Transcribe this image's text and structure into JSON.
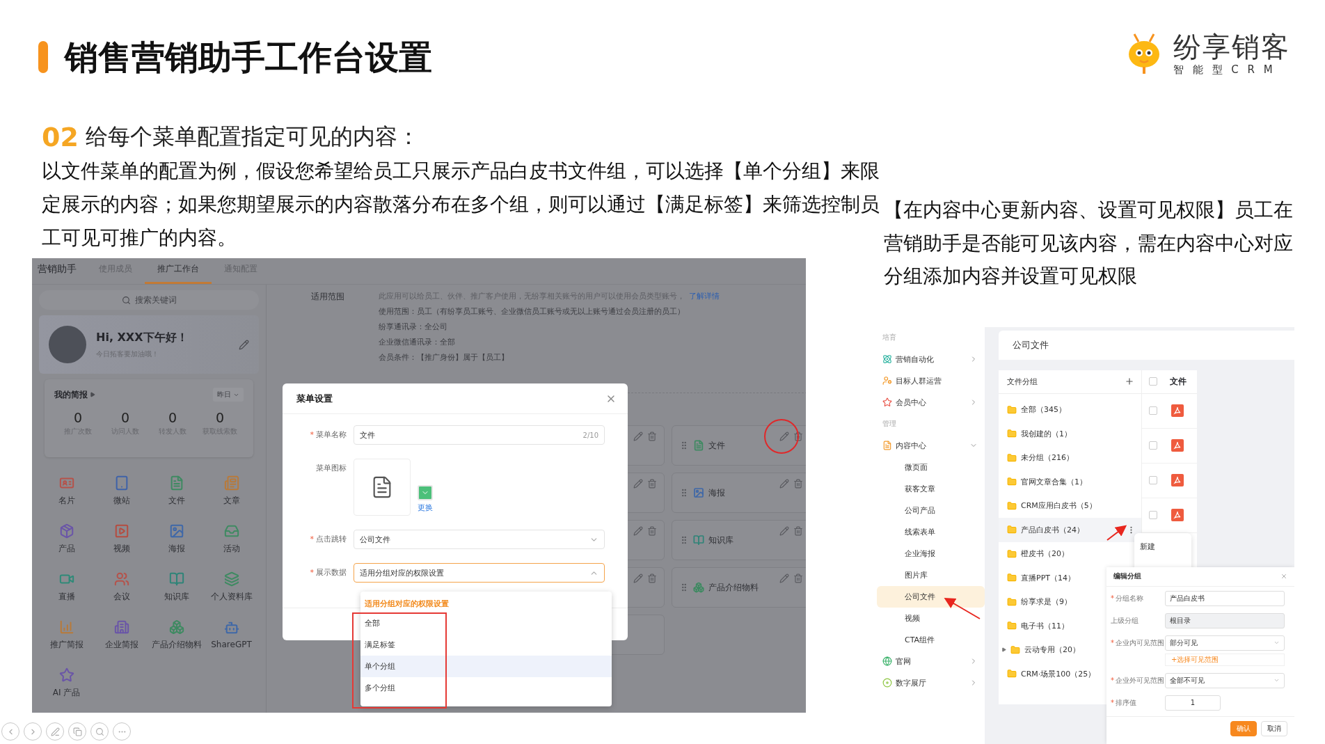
{
  "header": {
    "title": "销售营销助手工作台设置",
    "logo_name": "纷享销客",
    "logo_tagline": "智 能 型 C R M"
  },
  "intro": {
    "number": "02",
    "heading": "给每个菜单配置指定可见的内容：",
    "paragraph": "以文件菜单的配置为例，假设您希望给员工只展示产品白皮书文件组，可以选择【单个分组】来限定展示的内容；如果您期望展示的内容散落分布在多个组，则可以通过【满足标签】来筛选控制员工可见可推广的内容。",
    "note": "【在内容中心更新内容、设置可见权限】员工在营销助手是否能可见该内容，需在内容中心对应分组添加内容并设置可见权限"
  },
  "workbench": {
    "app_title": "营销助手",
    "tabs": [
      {
        "label": "使用成员",
        "selected": false
      },
      {
        "label": "推广工作台",
        "selected": true
      },
      {
        "label": "通知配置",
        "selected": false
      }
    ],
    "search": {
      "placeholder": "搜索关键词"
    },
    "profile": {
      "greeting": "Hi, XXX下午好！",
      "subtitle": "今日拓客要加油哦！"
    },
    "briefing": {
      "title": "我的简报",
      "period": "昨日",
      "stats": [
        {
          "value": "0",
          "label": "推广次数"
        },
        {
          "value": "0",
          "label": "访问人数"
        },
        {
          "value": "0",
          "label": "转发人数"
        },
        {
          "value": "0",
          "label": "获取线索数"
        }
      ]
    },
    "shortcuts": [
      {
        "label": "名片",
        "color": "#b5524a"
      },
      {
        "label": "微站",
        "color": "#3f62a8"
      },
      {
        "label": "文件",
        "color": "#3f8a62"
      },
      {
        "label": "文章",
        "color": "#b87a3a"
      },
      {
        "label": "产品",
        "color": "#6a55a8"
      },
      {
        "label": "视频",
        "color": "#b54c40"
      },
      {
        "label": "海报",
        "color": "#3f68a8"
      },
      {
        "label": "活动",
        "color": "#3f8a62"
      },
      {
        "label": "直播",
        "color": "#2f8a78"
      },
      {
        "label": "会议",
        "color": "#b5524a"
      },
      {
        "label": "知识库",
        "color": "#2f8478"
      },
      {
        "label": "个人资料库",
        "color": "#3f8a62"
      },
      {
        "label": "推广简报",
        "color": "#b87a3a"
      },
      {
        "label": "企业简报",
        "color": "#6a55a8"
      },
      {
        "label": "产品介绍物料",
        "color": "#3f8a62"
      },
      {
        "label": "ShareGPT",
        "color": "#3f68a8"
      },
      {
        "label": "AI 产品",
        "color": "#6a55a8"
      }
    ],
    "scope": {
      "label": "适用范围",
      "description": "此应用可以给员工、伙伴、推广客户使用，无纷享相关账号的用户可以使用会员类型账号，",
      "link": "了解详情",
      "lines": [
        "使用范围：员工（有纷享员工账号、企业微信员工账号或无以上账号通过会员注册的员工）",
        "纷享通讯录：全公司",
        "企业微信通讯录：全部",
        "会员条件：【推广身份】属于【员工】"
      ]
    },
    "menu_cards": [
      {
        "label": "文件",
        "color": "#3f8a62"
      },
      {
        "label": "海报",
        "color": "#3f68a8"
      },
      {
        "label": "知识库",
        "color": "#2f8478"
      },
      {
        "label": "产品介绍物料",
        "color": "#3f8a62"
      }
    ],
    "dialog": {
      "title": "菜单设置",
      "fields": [
        {
          "kind": "text",
          "marker": "*",
          "label": "菜单名称",
          "value": "文件",
          "counter": "2/10"
        },
        {
          "kind": "icon",
          "label": "菜单图标",
          "action": "更换"
        },
        {
          "kind": "select",
          "marker": "*",
          "label": "点击跳转",
          "value": "公司文件",
          "open": false
        },
        {
          "kind": "select",
          "marker": "*",
          "label": "展示数据",
          "value": "适用分组对应的权限设置",
          "open": true
        }
      ]
    },
    "dropdown": {
      "group": "适用分组对应的权限设置",
      "options": [
        {
          "label": "全部",
          "selected": false
        },
        {
          "label": "满足标签",
          "selected": false
        },
        {
          "label": "单个分组",
          "selected": true
        },
        {
          "label": "多个分组",
          "selected": false
        }
      ]
    }
  },
  "content_center": {
    "sidebar": [
      {
        "kind": "section",
        "label": "培育"
      },
      {
        "kind": "menu",
        "label": "营销自动化",
        "expanded": false
      },
      {
        "kind": "link",
        "label": "目标人群运营"
      },
      {
        "kind": "menu",
        "label": "会员中心",
        "expanded": false
      },
      {
        "kind": "section",
        "label": "管理"
      },
      {
        "kind": "menu",
        "label": "内容中心",
        "expanded": true,
        "children": [
          {
            "label": "微页面",
            "selected": false
          },
          {
            "label": "获客文章",
            "selected": false
          },
          {
            "label": "公司产品",
            "selected": false
          },
          {
            "label": "线索表单",
            "selected": false
          },
          {
            "label": "企业海报",
            "selected": false
          },
          {
            "label": "图片库",
            "selected": false
          },
          {
            "label": "公司文件",
            "selected": true
          },
          {
            "label": "视频",
            "selected": false
          },
          {
            "label": "CTA组件",
            "selected": false
          }
        ]
      },
      {
        "kind": "menu",
        "label": "官网",
        "expanded": false
      },
      {
        "kind": "menu",
        "label": "数字展厅",
        "expanded": false
      }
    ],
    "page_title": "公司文件",
    "groups": {
      "title": "文件分组",
      "items": [
        {
          "kind": "folder",
          "label": "全部（345）",
          "selected": false
        },
        {
          "kind": "folder",
          "label": "我创建的（1）",
          "selected": false
        },
        {
          "kind": "folder",
          "label": "未分组（216）",
          "selected": false
        },
        {
          "kind": "folder",
          "label": "官网文章合集（1）",
          "selected": false
        },
        {
          "kind": "folder",
          "label": "CRM应用白皮书（5）",
          "selected": false
        },
        {
          "kind": "folder",
          "label": "产品白皮书（24）",
          "selected": true
        },
        {
          "kind": "folder",
          "label": "橙皮书（20）",
          "selected": false
        },
        {
          "kind": "folder",
          "label": "直播PPT（14）",
          "selected": false
        },
        {
          "kind": "folder",
          "label": "纷享求是（9）",
          "selected": false
        },
        {
          "kind": "folder",
          "label": "电子书（11）",
          "selected": false
        },
        {
          "kind": "parent",
          "label": "云动专用（20）",
          "selected": false,
          "expanded": false
        },
        {
          "kind": "folder",
          "label": "CRM·场景100（25）",
          "selected": false
        }
      ]
    },
    "files": {
      "header": "文件",
      "header_checked": false,
      "rows": [
        {
          "checked": false
        },
        {
          "checked": false
        },
        {
          "checked": false
        },
        {
          "checked": false
        }
      ]
    },
    "context_menu": [
      "新建"
    ],
    "edit_dialog": {
      "title": "编辑分组",
      "fields": [
        {
          "kind": "text",
          "marker": "*",
          "label": "分组名称",
          "value": "产品白皮书"
        },
        {
          "kind": "disabled",
          "label": "上级分组",
          "value": "根目录"
        },
        {
          "kind": "select",
          "marker": "*",
          "label": "企业内可见范围",
          "value": "部分可见",
          "action": "+选择可见范围"
        },
        {
          "kind": "select",
          "marker": "*",
          "label": "企业外可见范围",
          "value": "全部不可见"
        },
        {
          "kind": "number",
          "marker": "*",
          "label": "排序值",
          "value": "1"
        }
      ],
      "buttons": [
        {
          "label": "确认",
          "kind": "primary"
        },
        {
          "label": "取消",
          "kind": "default"
        }
      ]
    }
  }
}
